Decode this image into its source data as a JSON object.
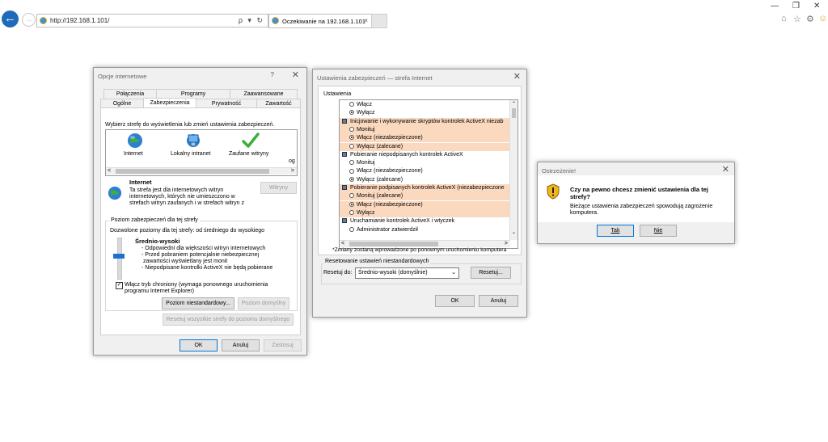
{
  "browser": {
    "url": "http://192.168.1.101/",
    "address_icons": "ρ ▾ ↻",
    "tab_title": "Oczekiwanie na 192.168.1.101",
    "tab_close": "×",
    "back_glyph": "←",
    "forward_glyph": "→",
    "win_minimize": "—",
    "win_restore": "❐",
    "win_close": "✕",
    "tool_home": "⌂",
    "tool_favorites": "☆",
    "tool_settings": "⚙",
    "tool_feedback": "☺"
  },
  "internet_options": {
    "title": "Opcje internetowe",
    "help": "?",
    "close": "✕",
    "tabs_row1": [
      "Połączenia",
      "Programy",
      "Zaawansowane"
    ],
    "tabs_row2": [
      "Ogólne",
      "Zabezpieczenia",
      "Prywatność",
      "Zawartość"
    ],
    "zone_prompt": "Wybierz strefę do wyświetlenia lub zmień ustawienia zabezpieczeń.",
    "zones": [
      "Internet",
      "Lokalny intranet",
      "Zaufane witryny",
      "og"
    ],
    "zone_name": "Internet",
    "zone_desc": [
      "Ta strefa jest dla internetowych witryn",
      "internetowych, których nie umieszczono w",
      "strefach witryn zaufanych i w strefach witryn z"
    ],
    "sites_button": "Witryny",
    "level_group": "Poziom zabezpieczeń dla tej strefy",
    "allowed_levels": "Dozwolone poziomy dla tej strefy: od średniego do wysokiego",
    "level_name": "Średnio-wysoki",
    "level_bullets": [
      "- Odpowiedni dla większości witryn internetowych",
      "- Przed pobraniem potencjalnie niebezpiecznej",
      "zawartości wyświetlany jest monit",
      "- Niepodpisane kontrolki ActiveX nie będą pobierane"
    ],
    "protected_mode": [
      "Włącz tryb chroniony (wymaga ponownego uruchomienia",
      "programu Internet Explorer)"
    ],
    "custom_level_button": "Poziom niestandardowy...",
    "default_level_button": "Poziom domyślny",
    "reset_all_button": "Resetuj wszystkie strefy do poziomu domyślnego",
    "ok": "OK",
    "cancel": "Anuluj",
    "apply": "Zastosuj"
  },
  "security_settings": {
    "title": "Ustawienia zabezpieczeń — strefa Internet",
    "close": "✕",
    "settings_label": "Ustawienia",
    "rows": [
      {
        "kind": "opt",
        "text": "Włącz",
        "on": false,
        "hl": false
      },
      {
        "kind": "opt",
        "text": "Wyłącz",
        "on": true,
        "hl": false
      },
      {
        "kind": "cat",
        "text": "Inicjowanie i wykonywanie skryptów kontrolek ActiveX niezab",
        "hl": true
      },
      {
        "kind": "opt",
        "text": "Monituj",
        "on": false,
        "hl": true
      },
      {
        "kind": "opt",
        "text": "Włącz (niezabezpieczone)",
        "on": true,
        "hl": true
      },
      {
        "kind": "opt",
        "text": "Wyłącz (zalecane)",
        "on": false,
        "hl": true
      },
      {
        "kind": "cat",
        "text": "Pobieranie niepodpisanych kontrolek ActiveX",
        "hl": false
      },
      {
        "kind": "opt",
        "text": "Monituj",
        "on": false,
        "hl": false
      },
      {
        "kind": "opt",
        "text": "Włącz (niezabezpieczone)",
        "on": false,
        "hl": false
      },
      {
        "kind": "opt",
        "text": "Wyłącz (zalecane)",
        "on": true,
        "hl": false
      },
      {
        "kind": "cat",
        "text": "Pobieranie podpisanych kontrolek ActiveX (niezabezpieczone",
        "hl": true
      },
      {
        "kind": "opt",
        "text": "Monituj (zalecane)",
        "on": false,
        "hl": true
      },
      {
        "kind": "opt",
        "text": "Włącz (niezabezpieczone)",
        "on": true,
        "hl": true
      },
      {
        "kind": "opt",
        "text": "Wyłącz",
        "on": false,
        "hl": true
      },
      {
        "kind": "cat",
        "text": "Uruchamianie kontrolek ActiveX i wtyczek",
        "hl": false
      },
      {
        "kind": "opt",
        "text": "Administrator zatwierdził",
        "on": false,
        "hl": false
      }
    ],
    "restart_note": "*Zmiany zostaną wprowadzone po ponownym uruchomieniu komputera",
    "reset_group": "Resetowanie ustawień niestandardowych",
    "reset_to_label": "Resetuj do:",
    "reset_to_value": "Średnio-wysoki (domyślnie)",
    "reset_button": "Resetuj...",
    "ok": "OK",
    "cancel": "Anuluj"
  },
  "warning": {
    "title": "Ostrzeżenie!",
    "close": "✕",
    "question": [
      "Czy na pewno chcesz zmienić ustawienia dla tej",
      "strefy?"
    ],
    "detail": [
      "Bieżące ustawienia zabezpieczeń spowodują zagrożenie",
      "komputera."
    ],
    "yes": "Tak",
    "no": "Nie"
  }
}
